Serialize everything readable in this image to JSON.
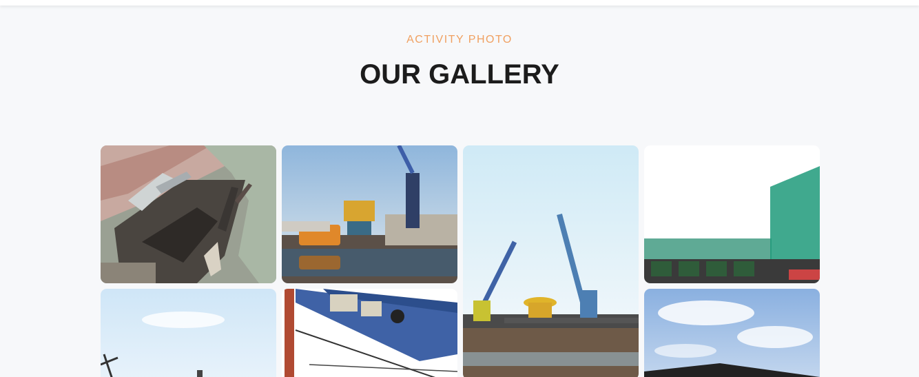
{
  "header": {
    "eyebrow": "ACTIVITY PHOTO",
    "title": "OUR GALLERY"
  },
  "gallery": {
    "items": [
      {
        "name": "aerial-port-photo"
      },
      {
        "name": "harbor-crane-photo"
      },
      {
        "name": "twin-cranes-photo"
      },
      {
        "name": "green-fence-trucks-photo"
      },
      {
        "name": "sky-crane-photo"
      },
      {
        "name": "crane-arm-closeup-photo"
      },
      {
        "name": "blue-sky-building-photo"
      }
    ]
  },
  "colors": {
    "accent": "#f0a060",
    "heading": "#1c1c1c",
    "background": "#f7f8fa"
  }
}
